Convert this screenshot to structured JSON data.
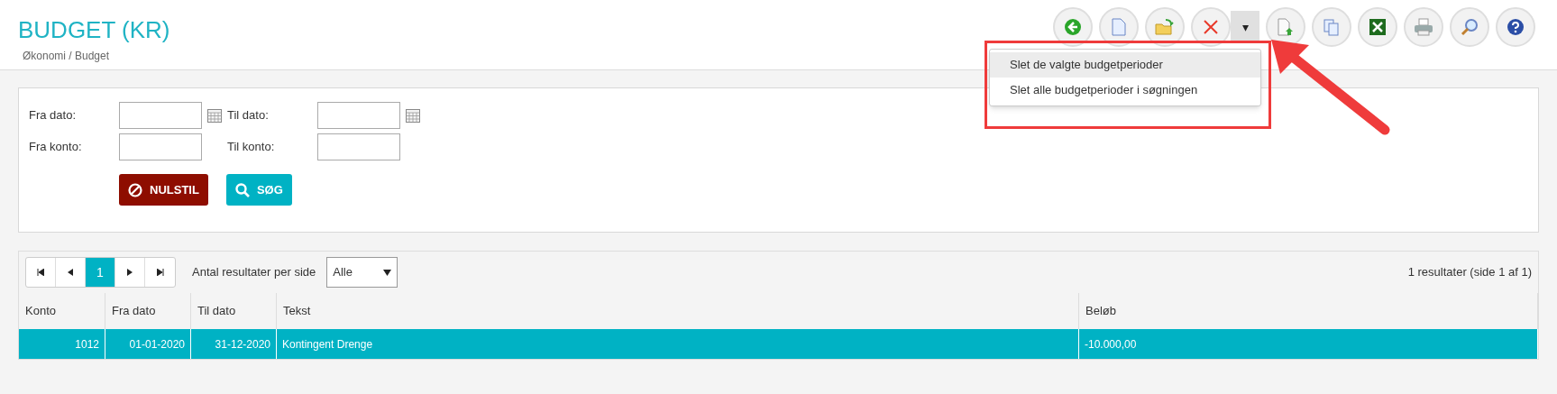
{
  "header": {
    "title": "BUDGET (KR)",
    "breadcrumb": "Økonomi / Budget"
  },
  "delete_menu": {
    "caret": "▾",
    "expanded": true,
    "items": [
      {
        "label": "Slet de valgte budgetperioder",
        "selected": true
      },
      {
        "label": "Slet alle budgetperioder i søgningen",
        "selected": false
      }
    ]
  },
  "filters": [
    {
      "label": "Fra dato:",
      "kind": "date"
    },
    {
      "label": "Til dato:",
      "kind": "date"
    },
    {
      "label": "Fra konto:",
      "kind": "text"
    },
    {
      "label": "Til konto:",
      "kind": "text"
    }
  ],
  "buttons": [
    {
      "label": "NULSTIL",
      "kind": "reset"
    },
    {
      "label": "SØG",
      "kind": "search"
    }
  ],
  "pager": {
    "pages": [
      {
        "label": "1",
        "selected": true
      }
    ],
    "per_page_label": "Antal resultater per side",
    "per_page_value": "Alle",
    "summary": "1 resultater (side 1 af 1)"
  },
  "table": {
    "columns": [
      {
        "label": "Konto"
      },
      {
        "label": "Fra dato"
      },
      {
        "label": "Til dato"
      },
      {
        "label": "Tekst"
      },
      {
        "label": "Beløb"
      }
    ],
    "rows": [
      {
        "selected": true,
        "cells": [
          "1012",
          "01-01-2020",
          "31-12-2020",
          "Kontingent Drenge",
          "-10.000,00"
        ]
      }
    ]
  }
}
